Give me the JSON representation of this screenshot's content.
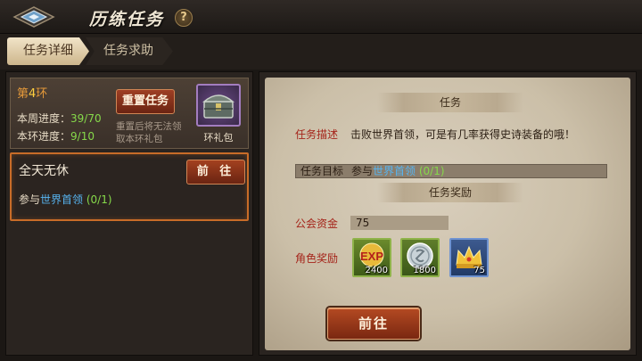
{
  "header": {
    "title": "历练任务",
    "help": "?"
  },
  "tabs": [
    {
      "label": "任务详细",
      "active": true
    },
    {
      "label": "任务求助",
      "active": false
    }
  ],
  "ring": {
    "prefix": "第",
    "number": "4",
    "suffix": "环",
    "weekly_label": "本周进度：",
    "weekly_value": "39/70",
    "ring_label": "本环进度：",
    "ring_value": "9/10",
    "reset_button": "重置任务",
    "reset_note": "重置后将无法领取本环礼包",
    "gift_label": "环礼包"
  },
  "task": {
    "name": "全天无休",
    "go_button": "前 往",
    "goal_prefix": "参与",
    "goal_target": "世界首领",
    "goal_progress": "(0/1)"
  },
  "detail": {
    "task_banner": "任务",
    "desc_label": "任务描述",
    "desc_text": "击败世界首领，可是有几率获得史诗装备的哦！",
    "goal_label": "任务目标",
    "goal_prefix": "参与",
    "goal_target": "世界首领",
    "goal_progress": "(0/1)",
    "reward_banner": "任务奖励",
    "guild_label": "公会资金",
    "guild_value": "75",
    "role_label": "角色奖励",
    "rewards": [
      {
        "icon": "exp-icon",
        "count": "2400"
      },
      {
        "icon": "silver-coin-icon",
        "count": "1800"
      },
      {
        "icon": "crown-icon",
        "count": "75"
      }
    ],
    "go_button": "前往"
  },
  "colors": {
    "accent_orange": "#c86c28",
    "progress_green": "#86d94a",
    "link_blue": "#57b4f0",
    "label_red": "#a5241a"
  }
}
